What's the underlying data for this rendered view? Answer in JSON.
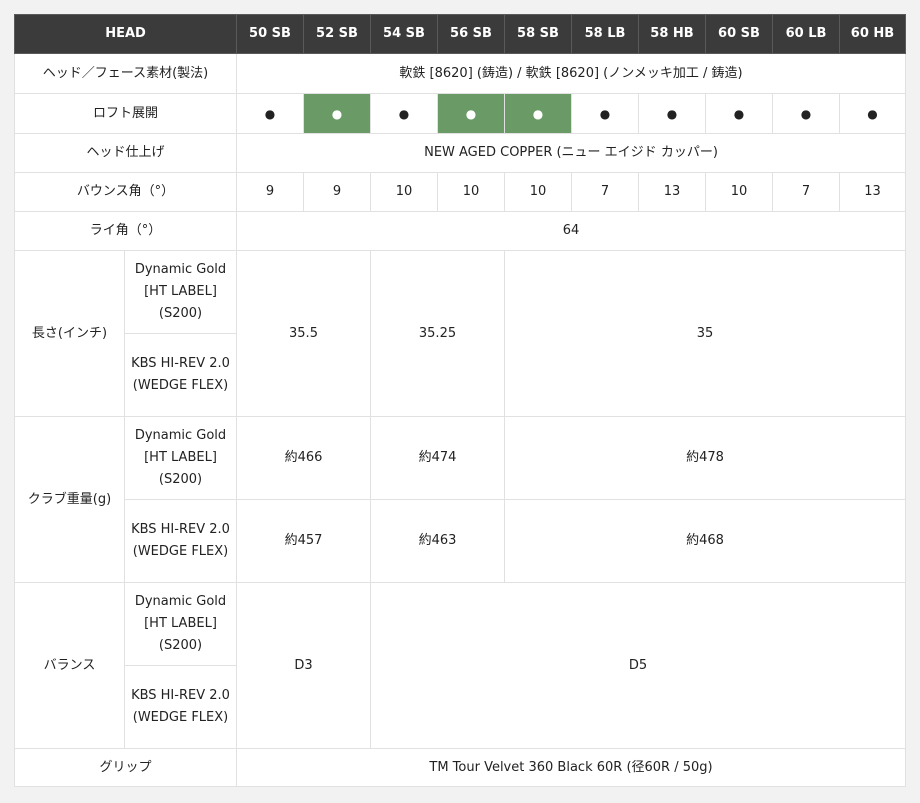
{
  "header": {
    "head_label": "HEAD",
    "models": [
      "50 SB",
      "52 SB",
      "54 SB",
      "56 SB",
      "58 SB",
      "58 LB",
      "58 HB",
      "60 SB",
      "60 LB",
      "60 HB"
    ]
  },
  "rows": {
    "material": {
      "label": "ヘッド／フェース素材(製法)",
      "value": "軟鉄 [8620] (鋳造) / 軟鉄 [8620] (ノンメッキ加工 / 鋳造)"
    },
    "loft": {
      "label": "ロフト展開",
      "marks": [
        "●",
        "●",
        "●",
        "●",
        "●",
        "●",
        "●",
        "●",
        "●",
        "●"
      ],
      "highlighted": [
        false,
        true,
        false,
        true,
        true,
        false,
        false,
        false,
        false,
        false
      ],
      "highlight_color": "#6a9a65"
    },
    "finish": {
      "label": "ヘッド仕上げ",
      "value": "NEW AGED COPPER (ニュー エイジド カッパー)"
    },
    "bounce": {
      "label": "バウンス角（°）",
      "values": [
        "9",
        "9",
        "10",
        "10",
        "10",
        "7",
        "13",
        "10",
        "7",
        "13"
      ]
    },
    "lie": {
      "label": "ライ角（°）",
      "value": "64"
    },
    "length": {
      "label": "長さ(インチ)",
      "shaft1": "Dynamic Gold [HT LABEL] (S200)",
      "shaft2": "KBS HI-REV 2.0 (WEDGE FLEX)",
      "values": [
        "35.5",
        "35.25",
        "35"
      ]
    },
    "weight": {
      "label": "クラブ重量(g)",
      "shaft1": "Dynamic Gold [HT LABEL] (S200)",
      "shaft2": "KBS HI-REV 2.0 (WEDGE FLEX)",
      "values_s1": [
        "約466",
        "約474",
        "約478"
      ],
      "values_s2": [
        "約457",
        "約463",
        "約468"
      ]
    },
    "balance": {
      "label": "バランス",
      "shaft1": "Dynamic Gold [HT LABEL] (S200)",
      "shaft2": "KBS HI-REV 2.0 (WEDGE FLEX)",
      "values": [
        "D3",
        "D5"
      ]
    },
    "grip": {
      "label": "グリップ",
      "value": "TM Tour Velvet 360 Black 60R (径60R / 50g)"
    }
  }
}
